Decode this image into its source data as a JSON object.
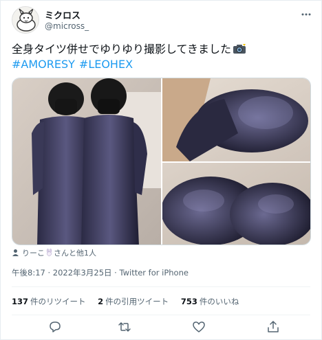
{
  "user": {
    "display_name": "ミクロス",
    "handle": "@micross_",
    "avatar_icon": "cartoon-avatar-icon"
  },
  "tweet": {
    "text": "全身タイツ併せでゆりゆり撮影してきました",
    "text_emoji": "camera-flash-emoji",
    "hashtags": [
      "#AMORESY",
      "#LEOHEX"
    ]
  },
  "media": {
    "photos": [
      {
        "description_icon": "photo-1"
      },
      {
        "description_icon": "photo-2"
      },
      {
        "description_icon": "photo-3"
      }
    ]
  },
  "tagged": {
    "name": "りーこ",
    "emoji": "rabbit-emoji",
    "suffix": "さんと他1人"
  },
  "timestamp": "午後8:17 · 2022年3月25日 · Twitter for iPhone",
  "stats": {
    "retweets_count": "137",
    "retweets_label": "件のリツイート",
    "quotes_count": "2",
    "quotes_label": "件の引用ツイート",
    "likes_count": "753",
    "likes_label": "件のいいね"
  },
  "colors": {
    "link": "#1d9bf0",
    "secondary_text": "#536471",
    "primary_text": "#0f1419"
  }
}
